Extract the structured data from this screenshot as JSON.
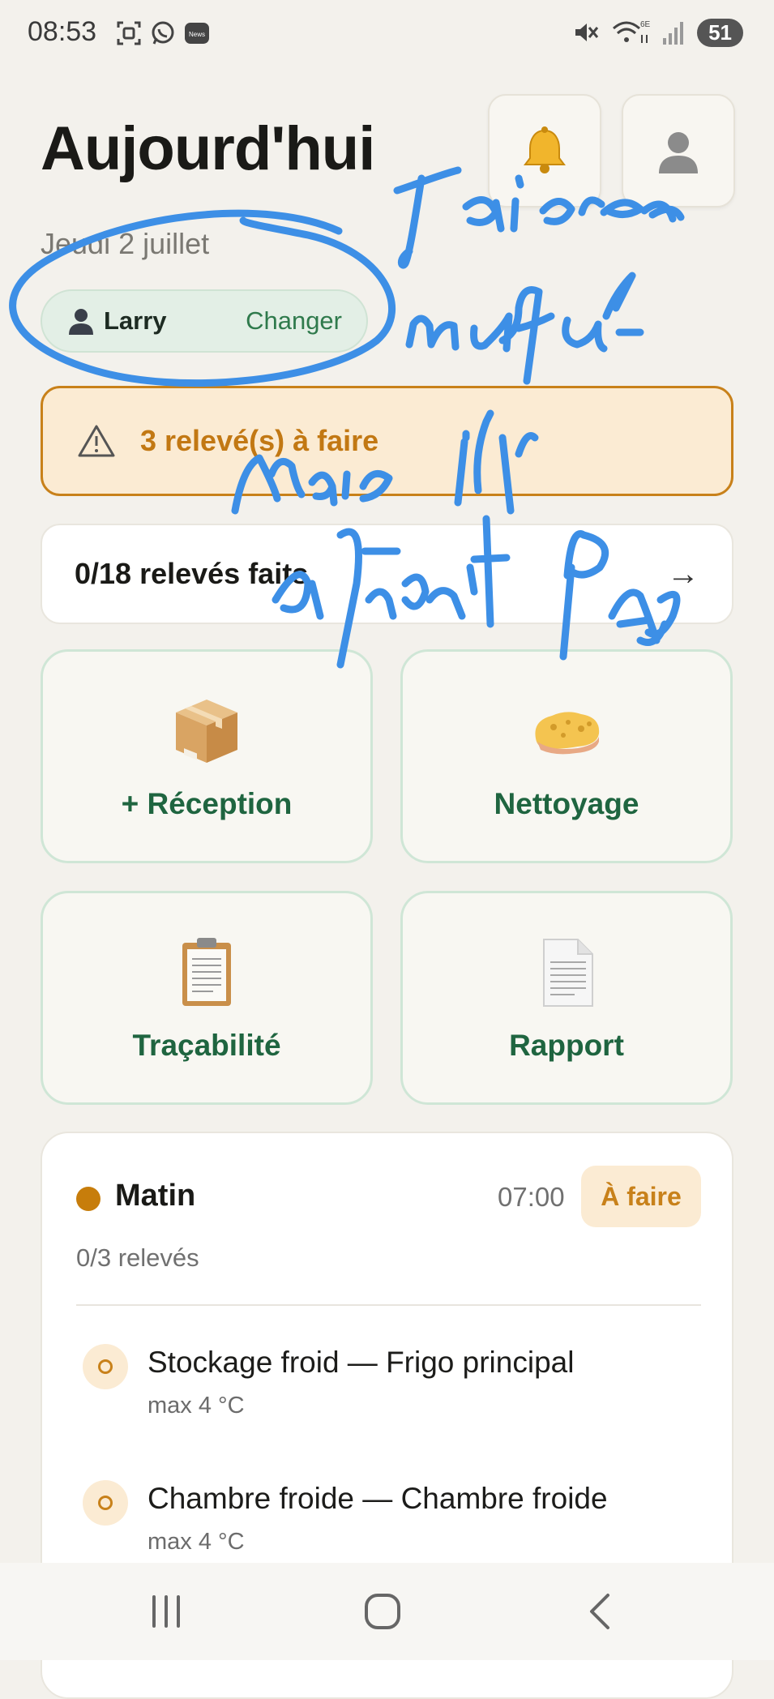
{
  "status_bar": {
    "time": "08:53",
    "battery": "51",
    "left_icons": [
      "screenshot-icon",
      "whatsapp-icon",
      "news-icon"
    ],
    "right_icons": [
      "mute-icon",
      "wifi-6e-icon",
      "signal-icon"
    ],
    "network_label": "6E"
  },
  "header": {
    "title": "Aujourd'hui",
    "date": "Jeudi 2 juillet",
    "notification_icon": "bell-icon",
    "profile_icon": "user-icon"
  },
  "user_chip": {
    "name": "Larry",
    "change_label": "Changer"
  },
  "alert": {
    "text": "3 relevé(s) à faire",
    "icon": "warning-icon",
    "color": "#c8811a"
  },
  "progress": {
    "text": "0/18 relevés faits",
    "arrow": "→"
  },
  "tiles": [
    {
      "label": "+ Réception",
      "icon": "package-icon"
    },
    {
      "label": "Nettoyage",
      "icon": "sponge-icon"
    },
    {
      "label": "Traçabilité",
      "icon": "clipboard-icon"
    },
    {
      "label": "Rapport",
      "icon": "document-icon"
    }
  ],
  "session": {
    "name": "Matin",
    "time": "07:00",
    "status": "À faire",
    "count": "0/3 relevés",
    "items": [
      {
        "title": "Stockage froid — Frigo principal",
        "limit": "max 4 °C"
      },
      {
        "title": "Chambre froide — Chambre froide",
        "limit": "max 4 °C"
      }
    ]
  },
  "annotation": {
    "handwritten_text": [
      "J'ai creer",
      "un profil",
      "Mais il",
      "affiche PAS"
    ]
  },
  "colors": {
    "accent_green": "#1f6540",
    "warning_orange": "#c8811a",
    "background": "#f3f1ec",
    "annotation_blue": "#3d8fe6"
  }
}
